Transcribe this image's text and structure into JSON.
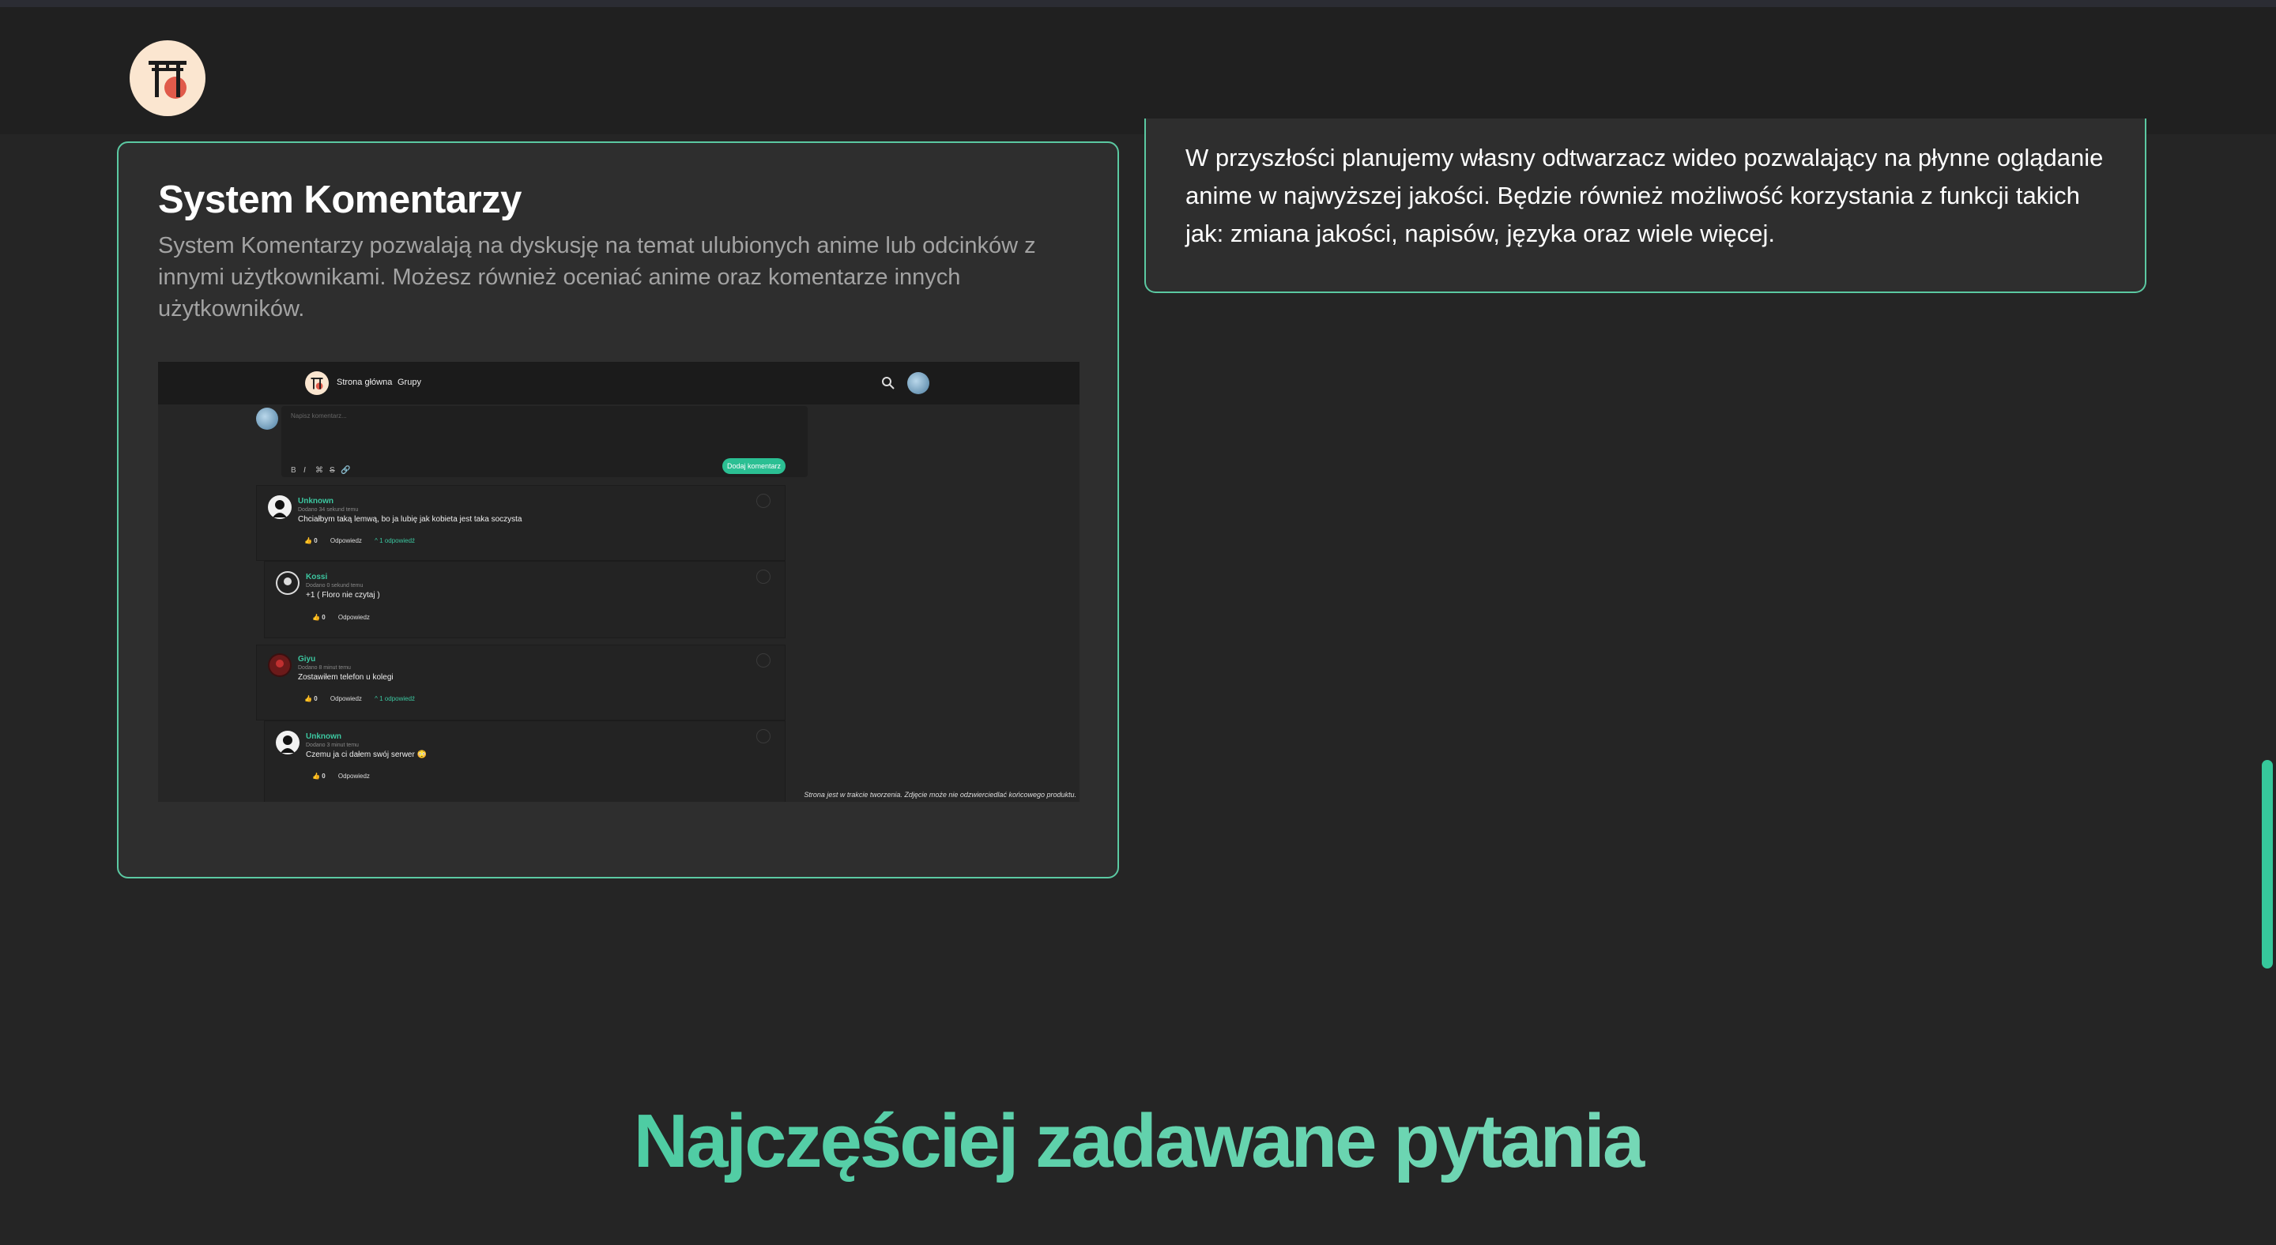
{
  "card_left": {
    "title": "System Komentarzy",
    "description": "System Komentarzy pozwalają na dyskusję na temat ulubionych anime lub odcinków z innymi użytkownikami. Możesz również oceniać anime oraz komentarze innych użytkowników."
  },
  "card_right": {
    "text": "W przyszłości planujemy własny odtwarzacz wideo pozwalający na płynne oglądanie anime w najwyższej jakości. Będzie również możliwość korzystania z funkcji takich jak: zmiana jakości, napisów, języka oraz wiele więcej."
  },
  "screenshot": {
    "nav": {
      "home": "Strona główna",
      "groups": "Grupy"
    },
    "editor": {
      "placeholder": "Napisz komentarz...",
      "toolbar": [
        "B",
        "I",
        "⌘",
        "S",
        "🔗"
      ],
      "submit": "Dodaj komentarz"
    },
    "comments": [
      {
        "name": "Unknown",
        "time": "Dodano 34 sekund temu",
        "text": "Chciałbym taką lemwą, bo ja lubię jak kobieta jest taka soczysta",
        "likes": "0",
        "reply": "Odpowiedz",
        "replies": "1 odpowiedź"
      },
      {
        "name": "Kossi",
        "time": "Dodano 0 sekund temu",
        "text": "+1 ( Floro nie czytaj )",
        "likes": "0",
        "reply": "Odpowiedz"
      },
      {
        "name": "Giyu",
        "time": "Dodano 8 minut temu",
        "text": "Zostawiłem telefon u kolegi",
        "likes": "0",
        "reply": "Odpowiedz",
        "replies": "1 odpowiedź"
      },
      {
        "name": "Unknown",
        "time": "Dodano 3 minut temu",
        "text": "Czemu ja ci dałem swój serwer 😳",
        "likes": "0",
        "reply": "Odpowiedz"
      }
    ],
    "note": "Strona jest w trakcie tworzenia. Zdjęcie może nie odzwierciedlać końcowego produktu."
  },
  "faq": {
    "title": "Najczęściej zadawane pytania"
  },
  "colors": {
    "accent": "#35c496",
    "background": "#252525",
    "card": "#2e2e2e"
  }
}
